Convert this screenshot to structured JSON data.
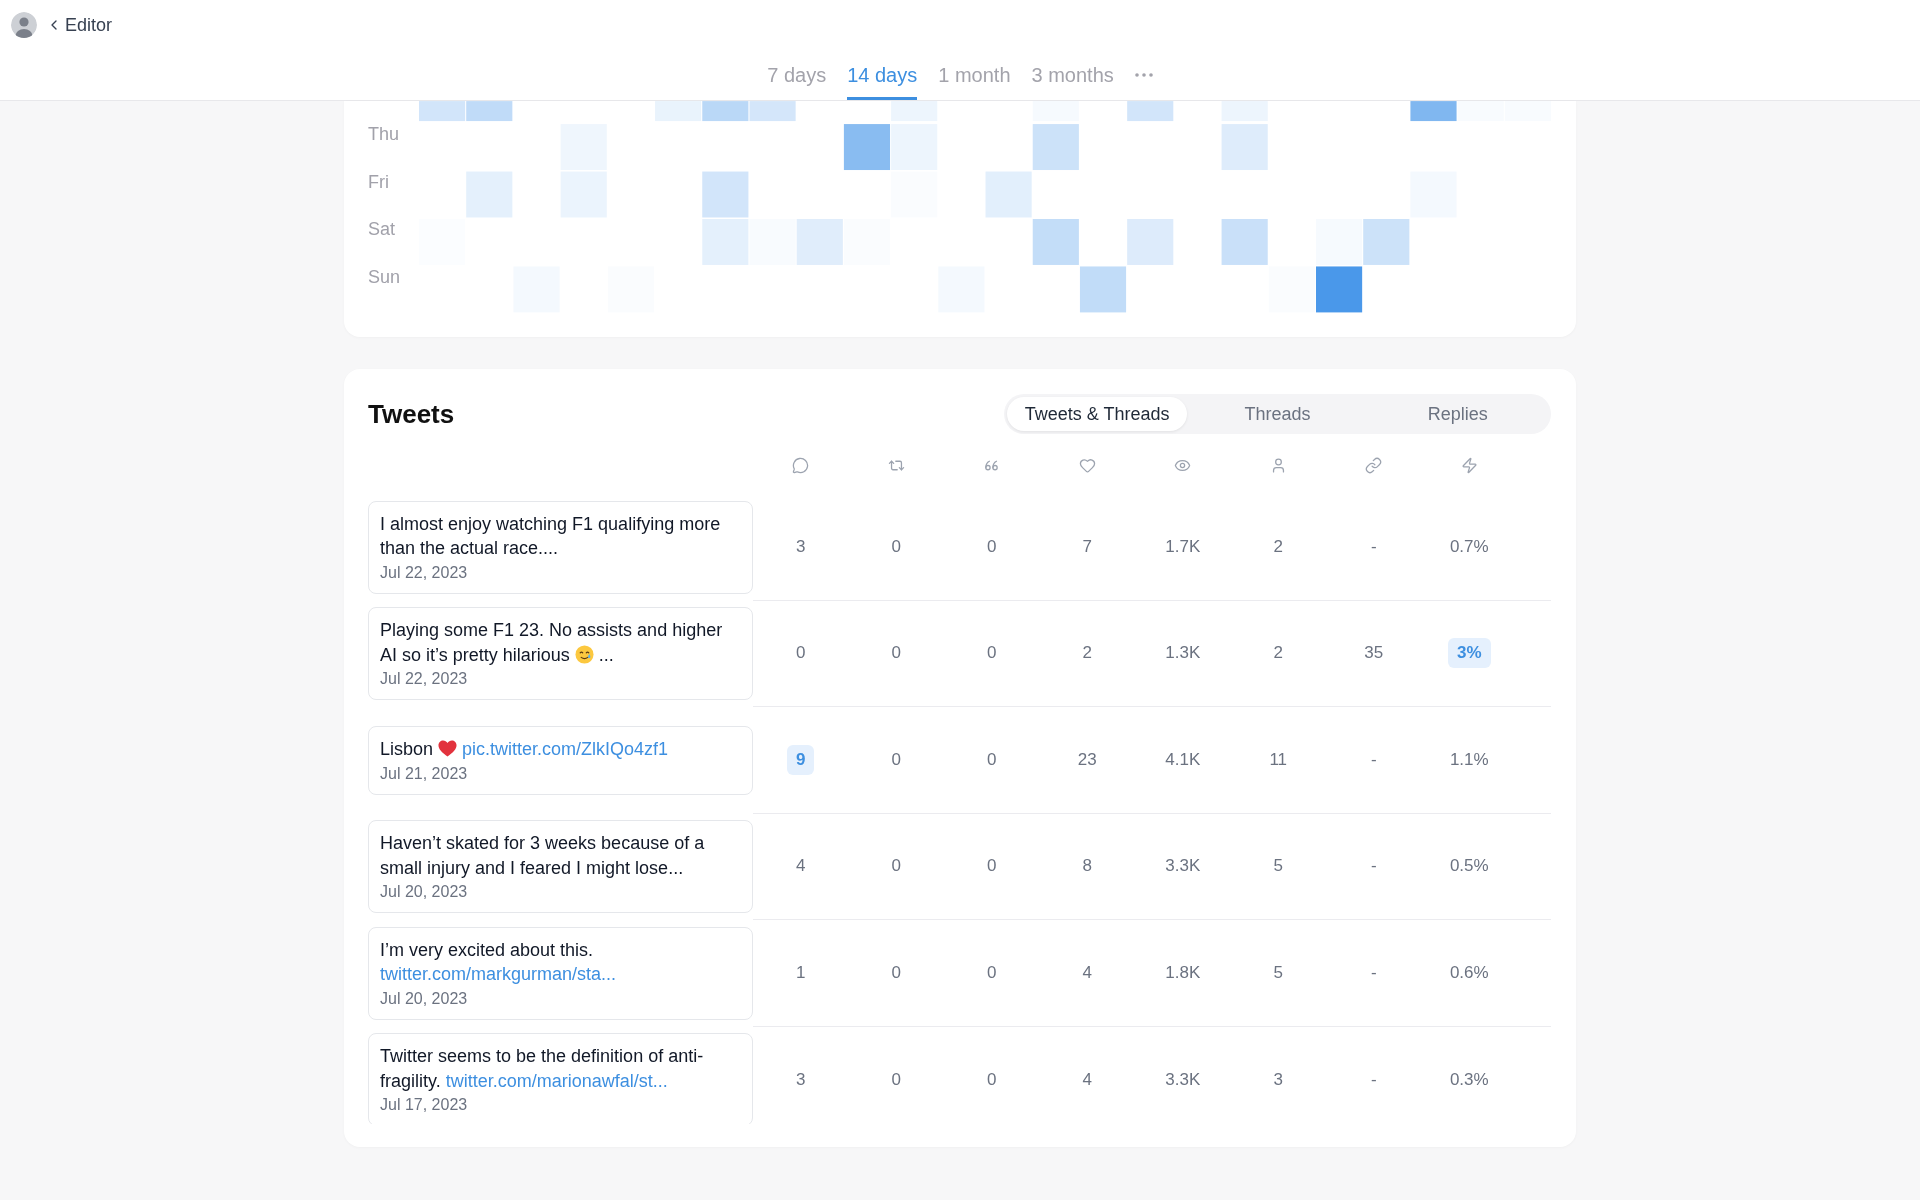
{
  "header": {
    "back_link": {
      "label": "Editor"
    },
    "periods": [
      {
        "label": "7 days",
        "selected": false
      },
      {
        "label": "14 days",
        "selected": true
      },
      {
        "label": "1 month",
        "selected": false
      },
      {
        "label": "3 months",
        "selected": false
      }
    ]
  },
  "heatmap": {
    "day_labels": [
      "Thu",
      "Fri",
      "Sat",
      "Sun"
    ]
  },
  "tweets": {
    "title": "Tweets",
    "filters": [
      {
        "label": "Tweets & Threads",
        "selected": true
      },
      {
        "label": "Threads",
        "selected": false
      },
      {
        "label": "Replies",
        "selected": false
      }
    ],
    "columns": [
      {
        "kind": "bubble"
      },
      {
        "kind": "repeat"
      },
      {
        "kind": "quote"
      },
      {
        "kind": "heart"
      },
      {
        "kind": "eye"
      },
      {
        "kind": "person"
      },
      {
        "kind": "chain"
      },
      {
        "kind": "bolt"
      }
    ],
    "rows": [
      {
        "content": [
          {
            "kind": "text",
            "text": "I almost enjoy watching F1 qualifying more than the actual race...."
          }
        ],
        "date": "Jul 22, 2023",
        "metrics": [
          {
            "text": "3",
            "highlighted": false
          },
          {
            "text": "0",
            "highlighted": false
          },
          {
            "text": "0",
            "highlighted": false
          },
          {
            "text": "7",
            "highlighted": false
          },
          {
            "text": "1.7K",
            "highlighted": false
          },
          {
            "text": "2",
            "highlighted": false
          },
          {
            "text": "-",
            "highlighted": false
          },
          {
            "text": "0.7%",
            "highlighted": false
          }
        ]
      },
      {
        "content": [
          {
            "kind": "text",
            "text": "Playing some F1 23. No assists and higher AI so it’s pretty hilarious "
          },
          {
            "kind": "face"
          },
          {
            "kind": "text",
            "text": "..."
          }
        ],
        "date": "Jul 22, 2023",
        "metrics": [
          {
            "text": "0",
            "highlighted": false
          },
          {
            "text": "0",
            "highlighted": false
          },
          {
            "text": "0",
            "highlighted": false
          },
          {
            "text": "2",
            "highlighted": false
          },
          {
            "text": "1.3K",
            "highlighted": false
          },
          {
            "text": "2",
            "highlighted": false
          },
          {
            "text": "35",
            "highlighted": false
          },
          {
            "text": "3%",
            "highlighted": true
          }
        ]
      },
      {
        "content": [
          {
            "kind": "text",
            "text": "Lisbon "
          },
          {
            "kind": "heart"
          },
          {
            "kind": "link",
            "text": "pic.twitter.com/ZlkIQo4zf1"
          }
        ],
        "date": "Jul 21, 2023",
        "metrics": [
          {
            "text": "9",
            "highlighted": true
          },
          {
            "text": "0",
            "highlighted": false
          },
          {
            "text": "0",
            "highlighted": false
          },
          {
            "text": "23",
            "highlighted": false
          },
          {
            "text": "4.1K",
            "highlighted": false
          },
          {
            "text": "11",
            "highlighted": false
          },
          {
            "text": "-",
            "highlighted": false
          },
          {
            "text": "1.1%",
            "highlighted": false
          }
        ]
      },
      {
        "content": [
          {
            "kind": "text",
            "text": "Haven’t skated for 3 weeks because of a small injury and I feared I might lose..."
          }
        ],
        "date": "Jul 20, 2023",
        "metrics": [
          {
            "text": "4",
            "highlighted": false
          },
          {
            "text": "0",
            "highlighted": false
          },
          {
            "text": "0",
            "highlighted": false
          },
          {
            "text": "8",
            "highlighted": false
          },
          {
            "text": "3.3K",
            "highlighted": false
          },
          {
            "text": "5",
            "highlighted": false
          },
          {
            "text": "-",
            "highlighted": false
          },
          {
            "text": "0.5%",
            "highlighted": false
          }
        ]
      },
      {
        "content": [
          {
            "kind": "text",
            "text": "I’m very excited about this. "
          },
          {
            "kind": "link",
            "text": "twitter.com/markgurman/sta..."
          }
        ],
        "date": "Jul 20, 2023",
        "metrics": [
          {
            "text": "1",
            "highlighted": false
          },
          {
            "text": "0",
            "highlighted": false
          },
          {
            "text": "0",
            "highlighted": false
          },
          {
            "text": "4",
            "highlighted": false
          },
          {
            "text": "1.8K",
            "highlighted": false
          },
          {
            "text": "5",
            "highlighted": false
          },
          {
            "text": "-",
            "highlighted": false
          },
          {
            "text": "0.6%",
            "highlighted": false
          }
        ]
      },
      {
        "content": [
          {
            "kind": "text",
            "text": "Twitter seems to be the definition of anti-fragility. "
          },
          {
            "kind": "link",
            "text": "twitter.com/marionawfal/st..."
          }
        ],
        "date": "Jul 17, 2023",
        "metrics": [
          {
            "text": "3",
            "highlighted": false
          },
          {
            "text": "0",
            "highlighted": false
          },
          {
            "text": "0",
            "highlighted": false
          },
          {
            "text": "4",
            "highlighted": false
          },
          {
            "text": "3.3K",
            "highlighted": false
          },
          {
            "text": "3",
            "highlighted": false
          },
          {
            "text": "-",
            "highlighted": false
          },
          {
            "text": "0.3%",
            "highlighted": false
          }
        ]
      }
    ]
  }
}
